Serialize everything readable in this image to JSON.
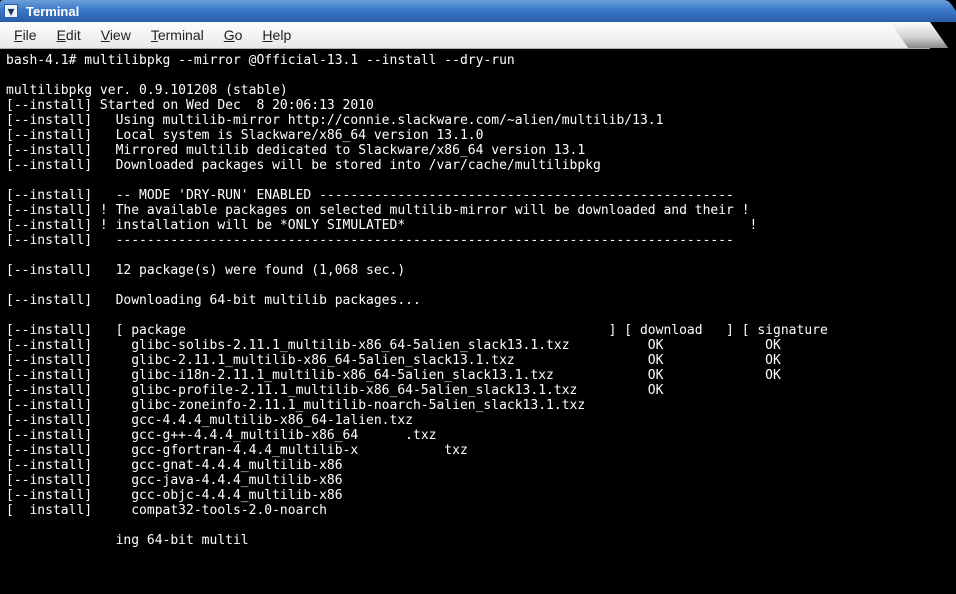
{
  "window": {
    "title": "Terminal"
  },
  "menu": {
    "file": {
      "label": "File",
      "accel_index": 0
    },
    "edit": {
      "label": "Edit",
      "accel_index": 0
    },
    "view": {
      "label": "View",
      "accel_index": 0
    },
    "terminal": {
      "label": "Terminal",
      "accel_index": 0
    },
    "go": {
      "label": "Go",
      "accel_index": 0
    },
    "help": {
      "label": "Help",
      "accel_index": 0
    }
  },
  "term": {
    "prompt": "bash-4.1# ",
    "command": "multilibpkg --mirror @Official-13.1 --install --dry-run",
    "lines": [
      "",
      "multilibpkg ver. 0.9.101208 (stable)",
      "[--install] Started on Wed Dec  8 20:06:13 2010",
      "[--install]   Using multilib-mirror http://connie.slackware.com/~alien/multilib/13.1",
      "[--install]   Local system is Slackware/x86_64 version 13.1.0",
      "[--install]   Mirrored multilib dedicated to Slackware/x86_64 version 13.1",
      "[--install]   Downloaded packages will be stored into /var/cache/multilibpkg",
      "",
      "[--install]   -- MODE 'DRY-RUN' ENABLED -----------------------------------------------------",
      "[--install] ! The available packages on selected multilib-mirror will be downloaded and their !",
      "[--install] ! installation will be *ONLY SIMULATED*                                            !",
      "[--install]   -------------------------------------------------------------------------------",
      "",
      "[--install]   12 package(s) were found (1,068 sec.)",
      "",
      "[--install]   Downloading 64-bit multilib packages...",
      "",
      "[--install]   [ package                                                      ] [ download   ] [ signature",
      "[--install]     glibc-solibs-2.11.1_multilib-x86_64-5alien_slack13.1.txz          OK             OK",
      "[--install]     glibc-2.11.1_multilib-x86_64-5alien_slack13.1.txz                 OK             OK",
      "[--install]     glibc-i18n-2.11.1_multilib-x86_64-5alien_slack13.1.txz            OK             OK",
      "[--install]     glibc-profile-2.11.1_multilib-x86_64-5alien_slack13.1.txz         OK",
      "[--install]     glibc-zoneinfo-2.11.1_multilib-noarch-5alien_slack13.1.txz",
      "[--install]     gcc-4.4.4_multilib-x86_64-1alien.txz",
      "[--install]     gcc-g++-4.4.4_multilib-x86_64      .txz",
      "[--install]     gcc-gfortran-4.4.4_multilib-x           txz",
      "[--install]     gcc-gnat-4.4.4_multilib-x86",
      "[--install]     gcc-java-4.4.4_multilib-x86",
      "[--install]     gcc-objc-4.4.4_multilib-x86",
      "[  install]     compat32-tools-2.0-noarch",
      "",
      "              ing 64-bit multil"
    ]
  }
}
